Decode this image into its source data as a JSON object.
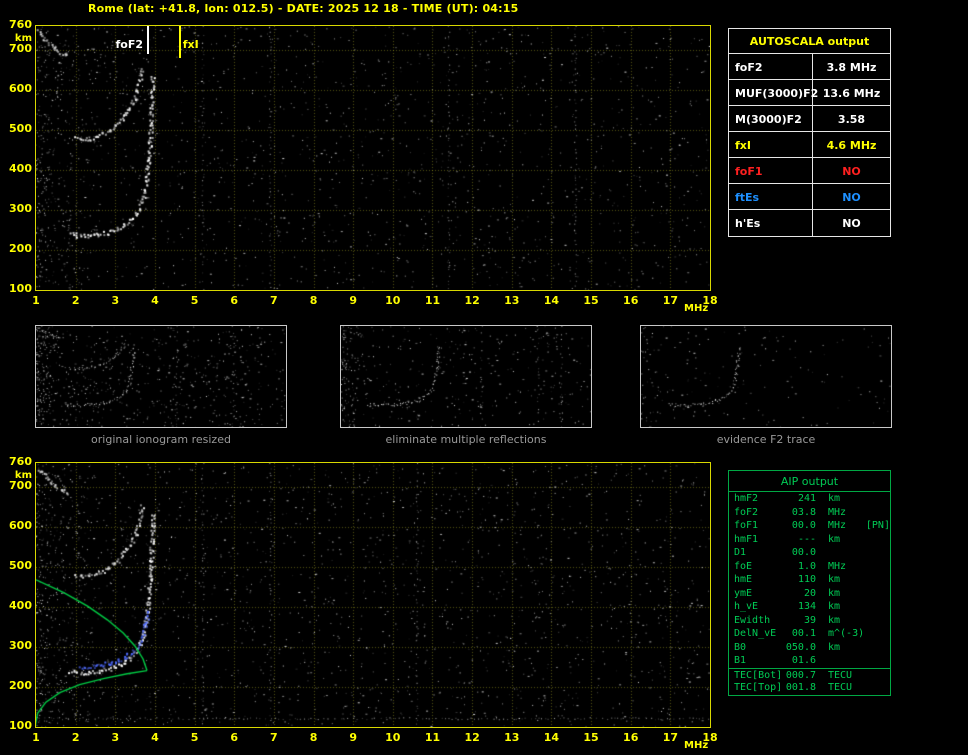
{
  "header": {
    "title": "Rome (lat: +41.8, lon: 012.5) - DATE: 2025 12 18 - TIME (UT): 04:15"
  },
  "colors": {
    "accent_yellow": "#ffff00",
    "plot_border": "#d8d800",
    "grid": "rgba(205,205,40,0.40)",
    "echo_white": "#ffffff",
    "profile_green": "#00cc44",
    "restored_blue": "#4f6bff",
    "table_border_white": "#e6e6e6",
    "aip_green": "#00cc55",
    "aip_border": "#00a844",
    "status_red": "#ff2020",
    "status_blue": "#1e90ff",
    "caption_gray": "#999999"
  },
  "autoscala": {
    "title": "AUTOSCALA output",
    "rows": [
      {
        "param": "foF2",
        "value": "3.8 MHz",
        "color": "#ffffff"
      },
      {
        "param": "MUF(3000)F2",
        "value": "13.6 MHz",
        "color": "#ffffff"
      },
      {
        "param": "M(3000)F2",
        "value": "3.58",
        "color": "#ffffff"
      },
      {
        "param": "fxI",
        "value": "4.6 MHz",
        "color": "#ffff00"
      },
      {
        "param": "foF1",
        "value": "NO",
        "color": "#ff2020"
      },
      {
        "param": "ftEs",
        "value": "NO",
        "color": "#1e90ff"
      },
      {
        "param": "h'Es",
        "value": "NO",
        "color": "#ffffff"
      }
    ]
  },
  "thumbnails": [
    {
      "caption": "original ionogram resized",
      "render": {
        "seed": 21,
        "noise": 520,
        "edge_clutter": 150,
        "interference_columns": [
          5.2,
          6.9
        ],
        "xlim": [
          1,
          8.5
        ],
        "ylim": [
          90,
          760
        ],
        "trace_dot": 1,
        "series": [
          "F2 trace (1st hop)",
          "F2 trace (2nd hop)",
          "near-range clutter"
        ]
      }
    },
    {
      "caption": "eliminate multiple reflections",
      "render": {
        "seed": 22,
        "noise": 320,
        "edge_clutter": 90,
        "interference_columns": [
          5.2,
          6.9,
          7.6
        ],
        "xlim": [
          1,
          8.5
        ],
        "ylim": [
          90,
          760
        ],
        "trace_dot": 1,
        "series": [
          "F2 trace (1st hop)"
        ]
      }
    },
    {
      "caption": "evidence F2 trace",
      "render": {
        "seed": 23,
        "noise": 140,
        "edge_clutter": 40,
        "interference_columns": [],
        "xlim": [
          1,
          8.5
        ],
        "ylim": [
          90,
          760
        ],
        "trace_dot": 1,
        "series": [
          "F2 trace (1st hop)"
        ]
      }
    }
  ],
  "aip": {
    "title": "AIP output",
    "rows": [
      {
        "param": "hmF2",
        "value": "241",
        "unit": "km",
        "note": ""
      },
      {
        "param": "foF2",
        "value": "03.8",
        "unit": "MHz",
        "note": ""
      },
      {
        "param": "foF1",
        "value": "00.0",
        "unit": "MHz",
        "note": "[PN]"
      },
      {
        "param": "hmF1",
        "value": "---",
        "unit": "km",
        "note": ""
      },
      {
        "param": "D1",
        "value": "00.0",
        "unit": "",
        "note": ""
      },
      {
        "param": "foE",
        "value": "1.0",
        "unit": "MHz",
        "note": ""
      },
      {
        "param": "hmE",
        "value": "110",
        "unit": "km",
        "note": ""
      },
      {
        "param": "ymE",
        "value": "20",
        "unit": "km",
        "note": ""
      },
      {
        "param": "h_vE",
        "value": "134",
        "unit": "km",
        "note": ""
      },
      {
        "param": "Ewidth",
        "value": "39",
        "unit": "km",
        "note": ""
      },
      {
        "param": "DelN_vE",
        "value": "00.1",
        "unit": "m^(-3)",
        "note": ""
      },
      {
        "param": "B0",
        "value": "050.0",
        "unit": "km",
        "note": ""
      },
      {
        "param": "B1",
        "value": "01.6",
        "unit": "",
        "note": ""
      },
      {
        "param": "TEC[Bot]",
        "value": "000.7",
        "unit": "TECU",
        "note": "",
        "sep": true
      },
      {
        "param": "TEC[Top]",
        "value": "001.8",
        "unit": "TECU",
        "note": ""
      }
    ]
  },
  "chart_data": [
    {
      "type": "scatter",
      "xlabel": "MHz",
      "ylabel": "km",
      "xlim": [
        1,
        18
      ],
      "ylim": [
        100,
        760
      ],
      "x_ticks": [
        1,
        2,
        3,
        4,
        5,
        6,
        7,
        8,
        9,
        10,
        11,
        12,
        13,
        14,
        15,
        16,
        17,
        18
      ],
      "y_ticks": [
        760,
        700,
        600,
        500,
        400,
        300,
        200,
        100
      ],
      "grid": true,
      "markers": [
        {
          "label": "foF2",
          "x": 3.8,
          "color": "#ffffff",
          "label_side": "left",
          "line_h": 28
        },
        {
          "label": "fxI",
          "x": 4.6,
          "color": "#ffff00",
          "label_side": "right",
          "line_h": 32
        }
      ],
      "series": [
        {
          "name": "F2 trace (1st hop)",
          "type": "echo",
          "color": "#ffffff",
          "points": [
            [
              1.85,
              242
            ],
            [
              2.05,
              238
            ],
            [
              2.3,
              237
            ],
            [
              2.55,
              240
            ],
            [
              2.8,
              246
            ],
            [
              3.0,
              252
            ],
            [
              3.2,
              262
            ],
            [
              3.38,
              276
            ],
            [
              3.52,
              293
            ],
            [
              3.64,
              316
            ],
            [
              3.73,
              346
            ],
            [
              3.8,
              392
            ],
            [
              3.85,
              452
            ],
            [
              3.89,
              522
            ],
            [
              3.92,
              592
            ],
            [
              3.94,
              640
            ]
          ]
        },
        {
          "name": "F2 trace (2nd hop)",
          "type": "echo",
          "color": "#e9e9e9",
          "points": [
            [
              2.0,
              480
            ],
            [
              2.2,
              477
            ],
            [
              2.45,
              482
            ],
            [
              2.7,
              492
            ],
            [
              2.95,
              508
            ],
            [
              3.15,
              528
            ],
            [
              3.35,
              556
            ],
            [
              3.5,
              586
            ],
            [
              3.6,
              622
            ],
            [
              3.68,
              658
            ]
          ]
        },
        {
          "name": "near-range clutter",
          "type": "echo",
          "color": "#cfcfcf",
          "points": [
            [
              1.05,
              748
            ],
            [
              1.3,
              722
            ],
            [
              1.55,
              701
            ],
            [
              1.82,
              684
            ]
          ]
        }
      ],
      "render": {
        "seed": 7,
        "grid": true,
        "noise": 1500,
        "edge_clutter": 320,
        "interference_columns": [
          5.2,
          6.9,
          11.4,
          14.6
        ],
        "trace_dot": 2
      }
    },
    {
      "type": "scatter",
      "xlabel": "MHz",
      "ylabel": "km",
      "xlim": [
        1,
        18
      ],
      "ylim": [
        100,
        760
      ],
      "x_ticks": [
        1,
        2,
        3,
        4,
        5,
        6,
        7,
        8,
        9,
        10,
        11,
        12,
        13,
        14,
        15,
        16,
        17,
        18
      ],
      "y_ticks": [
        760,
        700,
        600,
        500,
        400,
        300,
        200,
        100
      ],
      "grid": true,
      "series": [
        {
          "name": "F2 trace (1st hop)",
          "type": "echo",
          "color": "#ffffff",
          "points": [
            [
              1.85,
              242
            ],
            [
              2.05,
              238
            ],
            [
              2.3,
              237
            ],
            [
              2.55,
              240
            ],
            [
              2.8,
              246
            ],
            [
              3.0,
              252
            ],
            [
              3.2,
              262
            ],
            [
              3.38,
              276
            ],
            [
              3.52,
              293
            ],
            [
              3.64,
              316
            ],
            [
              3.73,
              346
            ],
            [
              3.8,
              392
            ],
            [
              3.85,
              452
            ],
            [
              3.89,
              522
            ],
            [
              3.92,
              592
            ],
            [
              3.94,
              640
            ]
          ]
        },
        {
          "name": "F2 trace (2nd hop)",
          "type": "echo",
          "color": "#e9e9e9",
          "points": [
            [
              2.0,
              480
            ],
            [
              2.2,
              477
            ],
            [
              2.45,
              482
            ],
            [
              2.7,
              492
            ],
            [
              2.95,
              508
            ],
            [
              3.15,
              528
            ],
            [
              3.35,
              556
            ],
            [
              3.5,
              586
            ],
            [
              3.6,
              622
            ],
            [
              3.68,
              658
            ]
          ]
        },
        {
          "name": "near-range clutter",
          "type": "echo",
          "color": "#cfcfcf",
          "points": [
            [
              1.05,
              748
            ],
            [
              1.3,
              722
            ],
            [
              1.55,
              701
            ],
            [
              1.82,
              684
            ]
          ]
        },
        {
          "name": "restored F2 trace",
          "type": "echo",
          "color": "#4f6bff",
          "points": [
            [
              2.1,
              252
            ],
            [
              2.4,
              253
            ],
            [
              2.7,
              258
            ],
            [
              3.0,
              265
            ],
            [
              3.25,
              276
            ],
            [
              3.45,
              291
            ],
            [
              3.6,
              311
            ],
            [
              3.7,
              336
            ],
            [
              3.78,
              366
            ],
            [
              3.82,
              396
            ]
          ]
        },
        {
          "name": "N(h) profile bottomside",
          "type": "line",
          "color": "#00cc44",
          "points": [
            [
              0.98,
              100
            ],
            [
              1.0,
              112
            ],
            [
              1.04,
              134
            ],
            [
              1.25,
              162
            ],
            [
              1.6,
              186
            ],
            [
              2.1,
              206
            ],
            [
              2.7,
              221
            ],
            [
              3.3,
              233
            ],
            [
              3.8,
              241
            ]
          ]
        },
        {
          "name": "N(h) profile topside",
          "type": "line",
          "color": "#00cc44",
          "points": [
            [
              3.8,
              241
            ],
            [
              3.7,
              270
            ],
            [
              3.5,
              302
            ],
            [
              3.2,
              335
            ],
            [
              2.8,
              368
            ],
            [
              2.3,
              402
            ],
            [
              1.7,
              436
            ],
            [
              1.0,
              468
            ]
          ]
        }
      ],
      "render": {
        "seed": 13,
        "grid": true,
        "noise": 1700,
        "edge_clutter": 380,
        "interference_columns": [
          5.2,
          6.9,
          10.6
        ],
        "hline_km": 122,
        "trace_dot": 2
      }
    }
  ]
}
